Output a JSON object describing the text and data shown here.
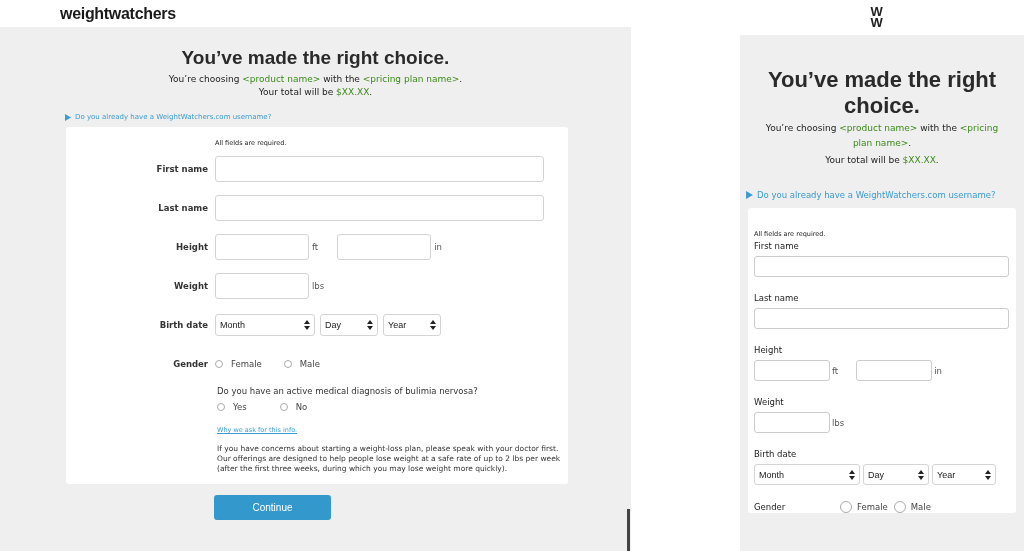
{
  "desktop": {
    "logo": "weightwatchers",
    "heading": "You’ve made the right choice.",
    "intro": [
      {
        "text": "You’re choosing ",
        "kind": "plain"
      },
      {
        "text": "<product name>",
        "kind": "placeholder"
      },
      {
        "text": " with the ",
        "kind": "plain"
      },
      {
        "text": "<pricing plan name>",
        "kind": "placeholder"
      },
      {
        "text": ".",
        "kind": "plain"
      }
    ],
    "total": [
      {
        "text": "Your total will be ",
        "kind": "plain"
      },
      {
        "text": "$XX.XX",
        "kind": "placeholder"
      },
      {
        "text": ".",
        "kind": "plain"
      }
    ],
    "username_link": "Do you already have a WeightWatchers.com username?",
    "required_note": "All fields are required.",
    "fields": [
      {
        "kind": "text",
        "label": "First name"
      },
      {
        "kind": "text",
        "label": "Last name"
      },
      {
        "kind": "measure",
        "label": "Height",
        "units": [
          "ft",
          "in"
        ]
      },
      {
        "kind": "measure",
        "label": "Weight",
        "units": [
          "lbs"
        ]
      },
      {
        "kind": "date",
        "label": "Birth date",
        "selects": [
          "Month",
          "Day",
          "Year"
        ]
      },
      {
        "kind": "radio",
        "label": "Gender",
        "options": [
          {
            "label": "Female",
            "selected": false
          },
          {
            "label": "Male",
            "selected": false
          }
        ]
      }
    ],
    "question": {
      "text": "Do you have an active medical diagnosis of bulimia nervosa?",
      "options": [
        {
          "label": "Yes",
          "selected": false
        },
        {
          "label": "No",
          "selected": false
        }
      ]
    },
    "why_link": "Why we ask for this info.",
    "disclaimer": "If you have concerns about starting a weight-loss plan, please speak with your doctor first. Our offerings are designed to help people lose weight at a safe rate of up to 2 lbs per week (after the first three weeks, during which you may lose weight more quickly).",
    "button": "Continue"
  },
  "mobile": {
    "logo": "WW",
    "heading": "You’ve made the right choice.",
    "intro": [
      {
        "text": "You’re choosing ",
        "kind": "plain"
      },
      {
        "text": "<product name>",
        "kind": "placeholder"
      },
      {
        "text": " with the ",
        "kind": "plain"
      },
      {
        "text": "<pricing plan name>",
        "kind": "placeholder"
      },
      {
        "text": ".",
        "kind": "plain"
      }
    ],
    "total": [
      {
        "text": "Your total will be ",
        "kind": "plain"
      },
      {
        "text": "$XX.XX",
        "kind": "placeholder"
      },
      {
        "text": ".",
        "kind": "plain"
      }
    ],
    "username_link": "Do you already have a WeightWatchers.com username?",
    "required_note": "All fields are required.",
    "fields": [
      {
        "kind": "text",
        "label": "First name"
      },
      {
        "kind": "text",
        "label": "Last name"
      },
      {
        "kind": "measure",
        "label": "Height",
        "units": [
          "ft",
          "in"
        ]
      },
      {
        "kind": "measure",
        "label": "Weight",
        "units": [
          "lbs"
        ]
      },
      {
        "kind": "date",
        "label": "Birth date",
        "selects": [
          "Month",
          "Day",
          "Year"
        ]
      },
      {
        "kind": "radio",
        "label": "Gender",
        "options": [
          {
            "label": "Female",
            "selected": false
          },
          {
            "label": "Male",
            "selected": false
          }
        ]
      }
    ]
  }
}
